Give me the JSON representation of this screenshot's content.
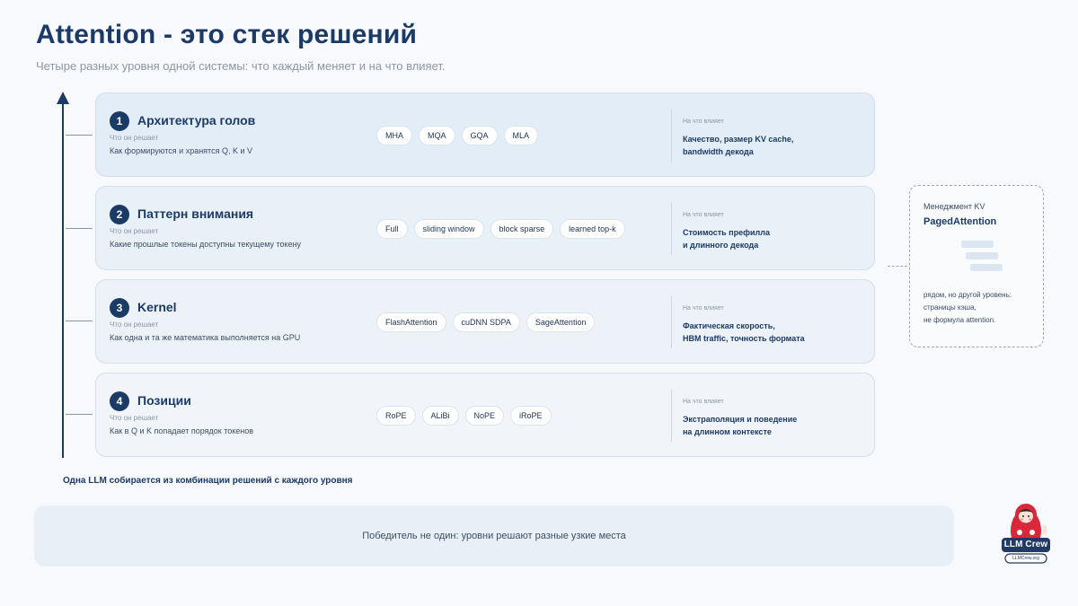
{
  "title": "Attention - это стек решений",
  "subtitle": "Четыре разных уровня одной системы: что каждый меняет и на что влияет.",
  "layers": [
    {
      "number": "1",
      "title": "Архитектура голов",
      "solves_label": "Что он решает",
      "solves": "Как формируются и хранятся Q, K и V",
      "options": [
        "MHA",
        "MQA",
        "GQA",
        "MLA"
      ],
      "impact_label": "На что влияет",
      "impact_line1": "Качество, размер KV cache,",
      "impact_line2": "bandwidth декода"
    },
    {
      "number": "2",
      "title": "Паттерн внимания",
      "solves_label": "Что он решает",
      "solves": "Какие прошлые токены доступны текущему токену",
      "options": [
        "Full",
        "sliding window",
        "block sparse",
        "learned top-k"
      ],
      "impact_label": "На что влияет",
      "impact_line1": "Стоимость префилла",
      "impact_line2": "и длинного декода"
    },
    {
      "number": "3",
      "title": "Kernel",
      "solves_label": "Что он решает",
      "solves": "Как одна и та же математика выполняется на GPU",
      "options": [
        "FlashAttention",
        "cuDNN SDPA",
        "SageAttention"
      ],
      "impact_label": "На что влияет",
      "impact_line1": "Фактическая скорость,",
      "impact_line2": "HBM traffic, точность формата"
    },
    {
      "number": "4",
      "title": "Позиции",
      "solves_label": "Что он решает",
      "solves": "Как в Q и K попадает порядок токенов",
      "options": [
        "RoPE",
        "ALiBi",
        "NoPE",
        "iRoPE"
      ],
      "impact_label": "На что влияет",
      "impact_line1": "Экстраполяция и поведение",
      "impact_line2": "на длинном контексте"
    }
  ],
  "combination_note": "Одна LLM собирается из комбинации решений с каждого уровня",
  "side_card": {
    "subtitle": "Менеджмент KV",
    "title": "PagedAttention",
    "note_line1": "рядом, но другой уровень:",
    "note_line2": "страницы кэша,",
    "note_line3": "не формула attention."
  },
  "bottom_banner": "Победитель не один: уровни решают разные узкие места",
  "logo": {
    "name": "LLM Crew",
    "icon": "matryoshka-icon",
    "site": "LLMCrew.org"
  },
  "colors": {
    "accent": "#1c3a66",
    "logo_red": "#d8283a",
    "logo_navy": "#223a63"
  }
}
